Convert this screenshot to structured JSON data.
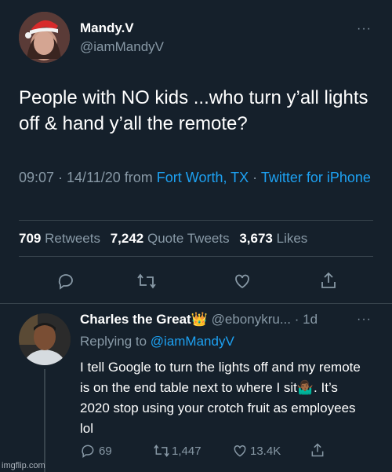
{
  "tweet": {
    "author_name": "Mandy.V",
    "author_handle": "@iamMandyV",
    "text": "People with NO kids ...who turn y’all lights off & hand y’all the remote?",
    "time_date": "09:07 · 14/11/20 from ",
    "location": "Fort Worth, TX",
    "separator": " · ",
    "client": "Twitter for iPhone",
    "retweets_count": "709",
    "retweets_label": "Retweets",
    "quotes_count": "7,242",
    "quotes_label": "Quote Tweets",
    "likes_count": "3,673",
    "likes_label": "Likes",
    "more_label": "···"
  },
  "reply": {
    "author_name": "Charles the Great👑",
    "author_handle": "@ebonykru...",
    "time": "· 1d",
    "more_label": "···",
    "replying_prefix": "Replying to ",
    "replying_to": "@iamMandyV",
    "text": "I tell Google to turn the lights off and my remote is on the end table next to where I sit🤷🏾‍♂️. It’s 2020 stop using your crotch fruit as employees lol",
    "reply_count": "69",
    "retweet_count": "1,447",
    "like_count": "13.4K"
  },
  "watermark": "imgflip.com",
  "colors": {
    "background": "#15202b",
    "secondary_text": "#8899a6",
    "link": "#1da1f2",
    "divider": "#38444d"
  },
  "icons": [
    "reply-icon",
    "retweet-icon",
    "like-icon",
    "share-icon",
    "more-icon"
  ]
}
